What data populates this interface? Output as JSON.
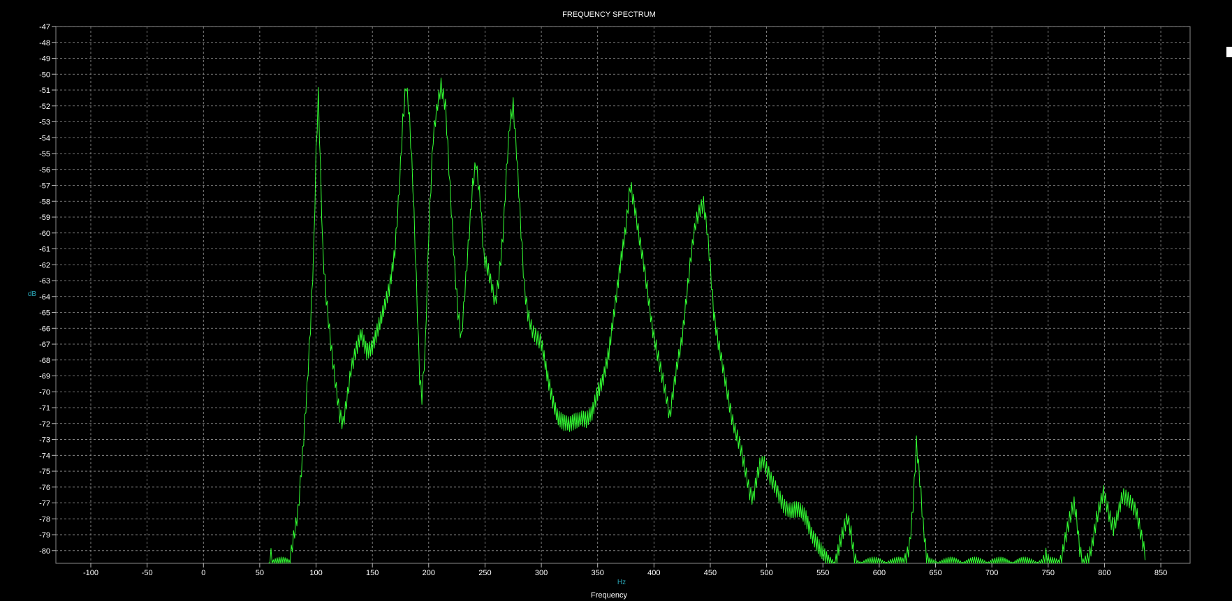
{
  "chart_data": {
    "type": "line",
    "title": "FREQUENCY SPECTRUM",
    "xlabel": "Frequency",
    "xunit": "Hz",
    "ylabel": "dB",
    "xlim": [
      -131,
      876
    ],
    "ylim": [
      -80.8,
      -47
    ],
    "x_ticks": [
      -100,
      -50,
      0,
      50,
      100,
      150,
      200,
      250,
      300,
      350,
      400,
      450,
      500,
      550,
      600,
      650,
      700,
      750,
      800,
      850
    ],
    "y_ticks": [
      -47,
      -48,
      -49,
      -50,
      -51,
      -52,
      -53,
      -54,
      -55,
      -56,
      -57,
      -58,
      -59,
      -60,
      -61,
      -62,
      -63,
      -64,
      -65,
      -66,
      -67,
      -68,
      -69,
      -70,
      -71,
      -72,
      -73,
      -74,
      -75,
      -76,
      -77,
      -78,
      -79,
      -80
    ],
    "grid": true,
    "series": [
      {
        "color": "#33ff33",
        "points": [
          [
            58,
            -81
          ],
          [
            60,
            -80.2
          ],
          [
            62,
            -81
          ],
          [
            76,
            -81
          ],
          [
            80,
            -79
          ],
          [
            84,
            -77.5
          ],
          [
            88,
            -74
          ],
          [
            92,
            -70
          ],
          [
            95,
            -66
          ],
          [
            98,
            -61
          ],
          [
            100,
            -55
          ],
          [
            102,
            -51.2
          ],
          [
            104,
            -56
          ],
          [
            106,
            -61
          ],
          [
            109,
            -64
          ],
          [
            113,
            -67
          ],
          [
            117,
            -69.5
          ],
          [
            121,
            -71.5
          ],
          [
            124,
            -72
          ],
          [
            127,
            -70.5
          ],
          [
            131,
            -68.5
          ],
          [
            135,
            -67.5
          ],
          [
            140,
            -66.5
          ],
          [
            145,
            -67.5
          ],
          [
            150,
            -67
          ],
          [
            155,
            -66
          ],
          [
            160,
            -65
          ],
          [
            165,
            -63.5
          ],
          [
            170,
            -61
          ],
          [
            174,
            -57
          ],
          [
            177,
            -53
          ],
          [
            180,
            -50.7
          ],
          [
            183,
            -53
          ],
          [
            186,
            -57
          ],
          [
            189,
            -63
          ],
          [
            192,
            -69
          ],
          [
            194,
            -70.2
          ],
          [
            197,
            -67
          ],
          [
            200,
            -60
          ],
          [
            204,
            -54
          ],
          [
            208,
            -52
          ],
          [
            211,
            -50.8
          ],
          [
            215,
            -52
          ],
          [
            219,
            -57
          ],
          [
            223,
            -62
          ],
          [
            226,
            -65
          ],
          [
            229,
            -66.8
          ],
          [
            232,
            -64
          ],
          [
            235,
            -61
          ],
          [
            239,
            -57
          ],
          [
            242,
            -55.4
          ],
          [
            246,
            -58
          ],
          [
            249,
            -61.5
          ],
          [
            253,
            -62.5
          ],
          [
            256,
            -63.5
          ],
          [
            259,
            -64.5
          ],
          [
            262,
            -63
          ],
          [
            266,
            -60
          ],
          [
            269,
            -56
          ],
          [
            272,
            -53
          ],
          [
            275,
            -52
          ],
          [
            278,
            -55
          ],
          [
            282,
            -60
          ],
          [
            285,
            -63.5
          ],
          [
            288,
            -65
          ],
          [
            292,
            -66
          ],
          [
            296,
            -66.5
          ],
          [
            300,
            -67
          ],
          [
            305,
            -69
          ],
          [
            310,
            -70.5
          ],
          [
            315,
            -71.5
          ],
          [
            320,
            -72
          ],
          [
            325,
            -72.2
          ],
          [
            330,
            -71.8
          ],
          [
            335,
            -71.5
          ],
          [
            340,
            -71.8
          ],
          [
            345,
            -71.5
          ],
          [
            350,
            -70
          ],
          [
            355,
            -69
          ],
          [
            360,
            -67.5
          ],
          [
            365,
            -65
          ],
          [
            370,
            -62
          ],
          [
            375,
            -59.5
          ],
          [
            379,
            -56.9
          ],
          [
            383,
            -58.5
          ],
          [
            387,
            -60.5
          ],
          [
            391,
            -62
          ],
          [
            395,
            -64
          ],
          [
            399,
            -66
          ],
          [
            403,
            -67.5
          ],
          [
            407,
            -69
          ],
          [
            411,
            -70.5
          ],
          [
            414,
            -71.7
          ],
          [
            417,
            -70
          ],
          [
            421,
            -68
          ],
          [
            425,
            -66.5
          ],
          [
            429,
            -64
          ],
          [
            433,
            -61.5
          ],
          [
            437,
            -59.5
          ],
          [
            441,
            -58.5
          ],
          [
            444,
            -58.1
          ],
          [
            447,
            -59.5
          ],
          [
            450,
            -62
          ],
          [
            453,
            -65
          ],
          [
            457,
            -67
          ],
          [
            461,
            -68.5
          ],
          [
            465,
            -70
          ],
          [
            469,
            -71.5
          ],
          [
            473,
            -72.5
          ],
          [
            477,
            -73.5
          ],
          [
            481,
            -75
          ],
          [
            485,
            -76.5
          ],
          [
            488,
            -76.8
          ],
          [
            491,
            -75.5
          ],
          [
            494,
            -74.5
          ],
          [
            497,
            -74.2
          ],
          [
            500,
            -74.8
          ],
          [
            504,
            -75.6
          ],
          [
            508,
            -76.2
          ],
          [
            512,
            -76.8
          ],
          [
            516,
            -77.2
          ],
          [
            520,
            -77.3
          ],
          [
            525,
            -77.4
          ],
          [
            530,
            -77.6
          ],
          [
            535,
            -78
          ],
          [
            540,
            -78.8
          ],
          [
            545,
            -79.6
          ],
          [
            550,
            -80.3
          ],
          [
            555,
            -80.8
          ],
          [
            560,
            -81
          ],
          [
            565,
            -79.5
          ],
          [
            569,
            -78.6
          ],
          [
            572,
            -78.1
          ],
          [
            575,
            -79
          ],
          [
            578,
            -80.5
          ],
          [
            581,
            -81
          ],
          [
            621,
            -81
          ],
          [
            624,
            -80.5
          ],
          [
            627,
            -79.5
          ],
          [
            630,
            -77
          ],
          [
            633,
            -73.2
          ],
          [
            636,
            -75.5
          ],
          [
            639,
            -78.5
          ],
          [
            642,
            -80.5
          ],
          [
            644,
            -81
          ],
          [
            745,
            -81
          ],
          [
            748,
            -80.4
          ],
          [
            751,
            -81
          ],
          [
            760,
            -81
          ],
          [
            764,
            -79.5
          ],
          [
            768,
            -78.3
          ],
          [
            771,
            -77.5
          ],
          [
            773,
            -77.2
          ],
          [
            775,
            -78
          ],
          [
            778,
            -80
          ],
          [
            781,
            -81
          ],
          [
            785,
            -80.5
          ],
          [
            789,
            -79.5
          ],
          [
            793,
            -78
          ],
          [
            796,
            -77.2
          ],
          [
            799,
            -76.5
          ],
          [
            802,
            -77.2
          ],
          [
            805,
            -78
          ],
          [
            808,
            -78.5
          ],
          [
            812,
            -77.5
          ],
          [
            816,
            -76.5
          ],
          [
            820,
            -76.8
          ],
          [
            824,
            -77.2
          ],
          [
            828,
            -77.6
          ],
          [
            831,
            -78.4
          ],
          [
            834,
            -79.4
          ],
          [
            836,
            -80
          ]
        ]
      }
    ]
  }
}
